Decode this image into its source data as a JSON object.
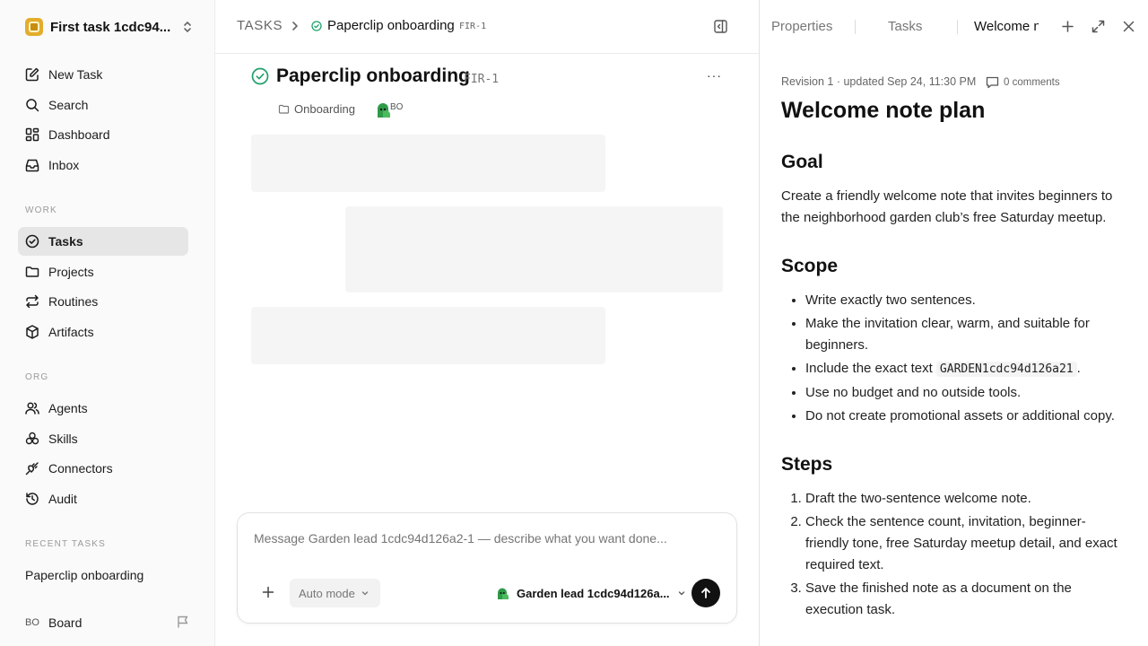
{
  "sidebar": {
    "workspace_name": "First task 1cdc94...",
    "nav_top": [
      {
        "label": "New Task",
        "icon": "edit-icon"
      },
      {
        "label": "Search",
        "icon": "search-icon"
      },
      {
        "label": "Dashboard",
        "icon": "dashboard-icon"
      },
      {
        "label": "Inbox",
        "icon": "inbox-icon"
      }
    ],
    "work_label": "WORK",
    "work_items": [
      {
        "label": "Tasks",
        "icon": "check-circle-icon",
        "active": true
      },
      {
        "label": "Projects",
        "icon": "folder-icon"
      },
      {
        "label": "Routines",
        "icon": "repeat-icon"
      },
      {
        "label": "Artifacts",
        "icon": "box-icon"
      }
    ],
    "org_label": "ORG",
    "org_items": [
      {
        "label": "Agents",
        "icon": "users-icon"
      },
      {
        "label": "Skills",
        "icon": "skills-icon"
      },
      {
        "label": "Connectors",
        "icon": "plug-icon"
      },
      {
        "label": "Audit",
        "icon": "history-icon"
      }
    ],
    "recent_label": "RECENT TASKS",
    "recent_items": [
      "Paperclip onboarding"
    ],
    "board_initials": "BO",
    "board_label": "Board"
  },
  "header": {
    "breadcrumb_root": "TASKS",
    "breadcrumb_title": "Paperclip onboarding",
    "breadcrumb_id": "FIR-1"
  },
  "task": {
    "title": "Paperclip onboarding",
    "id": "FIR-1",
    "more_label": "···",
    "project": "Onboarding",
    "assignee_initials": "BO",
    "status_color": "#22a06b"
  },
  "composer": {
    "placeholder": "Message Garden lead 1cdc94d126a2-1 — describe what you want done...",
    "mode_label": "Auto mode",
    "agent_label": "Garden lead 1cdc94d126a..."
  },
  "right_panel": {
    "tabs": [
      "Properties",
      "Tasks",
      "Welcome n"
    ],
    "revision_text": "Revision 1 · updated Sep 24, 11:30 PM",
    "comments_label": "0 comments",
    "doc": {
      "title": "Welcome note plan",
      "goal_heading": "Goal",
      "goal_text": "Create a friendly welcome note that invites beginners to the neighborhood garden club’s free Saturday meetup.",
      "scope_heading": "Scope",
      "scope_items": [
        "Write exactly two sentences.",
        "Make the invitation clear, warm, and suitable for beginners.",
        "Use no budget and no outside tools.",
        "Do not create promotional assets or additional copy."
      ],
      "scope_code_prefix": "Include the exact text ",
      "scope_code": "GARDEN1cdc94d126a21",
      "scope_code_suffix": ".",
      "steps_heading": "Steps",
      "steps_items": [
        "Draft the two-sentence welcome note.",
        "Check the sentence count, invitation, beginner-friendly tone, free Saturday meetup detail, and exact required text.",
        "Save the finished note as a document on the execution task."
      ]
    }
  },
  "colors": {
    "success": "#22a06b",
    "sidebar_bg": "#fafafa",
    "active_bg": "#e6e6e6",
    "skeleton": "#f5f5f5",
    "send_button": "#111111"
  }
}
